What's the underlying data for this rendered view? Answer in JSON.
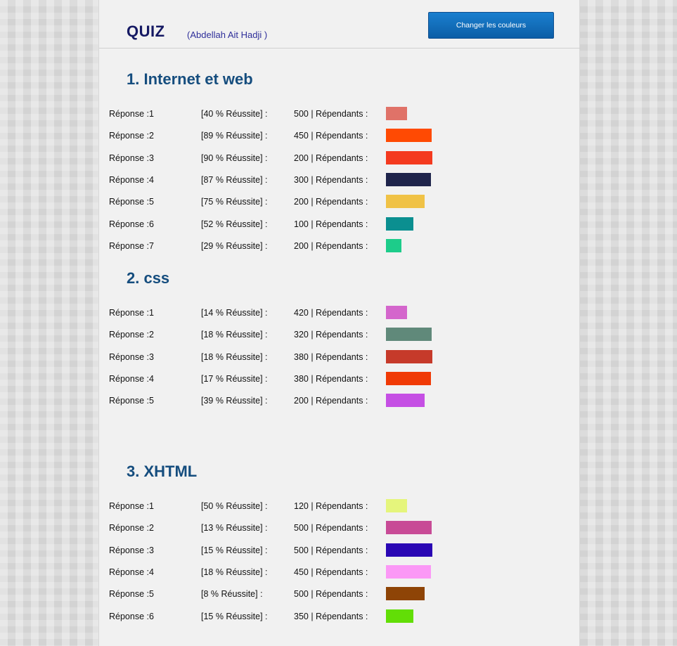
{
  "header": {
    "title": "QUIZ",
    "author": "(Abdellah Ait Hadji )",
    "button_label": "Changer les couleurs"
  },
  "sections": [
    {
      "title": "1. Internet et web",
      "rows": [
        {
          "label": "Réponse :1",
          "rate": "[40 % Réussite] :",
          "respondents": "500 | Répendants :",
          "color": "#e07268"
        },
        {
          "label": "Réponse :2",
          "rate": "[89 % Réussite] :",
          "respondents": "450 | Répendants :",
          "color": "#ff4a03"
        },
        {
          "label": "Réponse :3",
          "rate": "[90 % Réussite] :",
          "respondents": "200 | Répendants :",
          "color": "#f43a1f"
        },
        {
          "label": "Réponse :4",
          "rate": "[87 % Réussite] :",
          "respondents": "300 | Répendants :",
          "color": "#1f244b"
        },
        {
          "label": "Réponse :5",
          "rate": "[75 % Réussite] :",
          "respondents": "200 | Répendants :",
          "color": "#f0c246"
        },
        {
          "label": "Réponse :6",
          "rate": "[52 % Réussite] :",
          "respondents": "100 | Répendants :",
          "color": "#0b8f90"
        },
        {
          "label": "Réponse :7",
          "rate": "[29 % Réussite] :",
          "respondents": "200 | Répendants :",
          "color": "#1dcc8a"
        }
      ]
    },
    {
      "title": "2. css",
      "rows": [
        {
          "label": "Réponse :1",
          "rate": "[14 % Réussite] :",
          "respondents": "420 | Répendants :",
          "color": "#d466cc"
        },
        {
          "label": "Réponse :2",
          "rate": "[18 % Réussite] :",
          "respondents": "320 | Répendants :",
          "color": "#60897a"
        },
        {
          "label": "Réponse :3",
          "rate": "[18 % Réussite] :",
          "respondents": "380 | Répendants :",
          "color": "#c63a2a"
        },
        {
          "label": "Réponse :4",
          "rate": "[17 % Réussite] :",
          "respondents": "380 | Répendants :",
          "color": "#f03a06"
        },
        {
          "label": "Réponse :5",
          "rate": "[39 % Réussite] :",
          "respondents": "200 | Répendants :",
          "color": "#c54fe4"
        }
      ]
    },
    {
      "title": "3. XHTML",
      "rows": [
        {
          "label": "Réponse :1",
          "rate": "[50 % Réussite] :",
          "respondents": "120 | Répendants :",
          "color": "#e5f57c"
        },
        {
          "label": "Réponse :2",
          "rate": "[13 % Réussite] :",
          "respondents": "500 | Répendants :",
          "color": "#c84b96"
        },
        {
          "label": "Réponse :3",
          "rate": "[15 % Réussite] :",
          "respondents": "500 | Répendants :",
          "color": "#2a07b4"
        },
        {
          "label": "Réponse :4",
          "rate": "[18 % Réussite] :",
          "respondents": "450 | Répendants :",
          "color": "#fb98f6"
        },
        {
          "label": "Réponse :5",
          "rate": "[8 % Réussite] :",
          "respondents": "500 | Répendants :",
          "color": "#8e4406"
        },
        {
          "label": "Réponse :6",
          "rate": "[15 % Réussite] :",
          "respondents": "350 | Répendants :",
          "color": "#62de06"
        }
      ]
    }
  ]
}
